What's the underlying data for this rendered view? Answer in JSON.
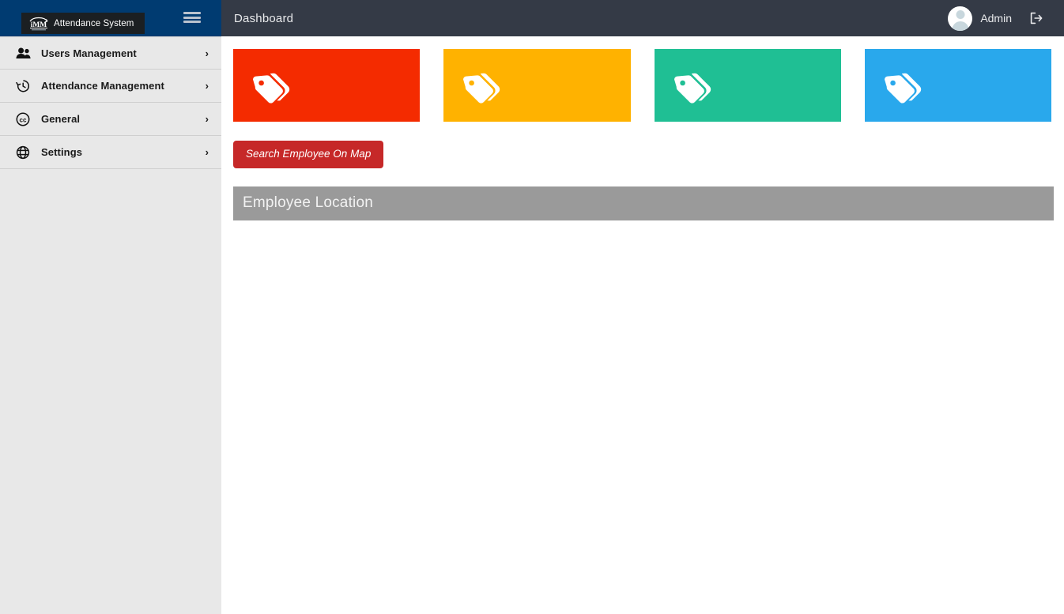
{
  "brand": {
    "logo_icon": "imm-logo-icon",
    "logo_text": "Attendance System",
    "menu_toggle_icon": "hamburger-menu-icon"
  },
  "sidebar": {
    "items": [
      {
        "label": "Users Management",
        "icon": "users-icon",
        "caret": "›"
      },
      {
        "label": "Attendance Management",
        "icon": "clock-history-icon",
        "caret": "›"
      },
      {
        "label": "General",
        "icon": "cc-circle-icon",
        "caret": "›"
      },
      {
        "label": "Settings",
        "icon": "globe-icon",
        "caret": "›"
      }
    ]
  },
  "topbar": {
    "title": "Dashboard",
    "user_name": "Admin",
    "avatar_icon": "user-avatar-icon",
    "logout_icon": "logout-icon"
  },
  "main": {
    "cards": [
      {
        "name": "card-red",
        "color": "#f42b00",
        "icon": "tags-icon"
      },
      {
        "name": "card-orange",
        "color": "#ffb200",
        "icon": "tags-icon"
      },
      {
        "name": "card-green",
        "color": "#1fbf94",
        "icon": "tags-icon"
      },
      {
        "name": "card-blue",
        "color": "#29a8ec",
        "icon": "tags-icon"
      }
    ],
    "search_button_label": "Search Employee On Map",
    "panel_title": "Employee Location"
  },
  "colors": {
    "sidebar_brand": "#003b71",
    "sidebar_bg": "#e8e8e8",
    "topbar_bg": "#343a46",
    "accent_red": "#c62828",
    "panel_header": "#9a9a9a"
  }
}
